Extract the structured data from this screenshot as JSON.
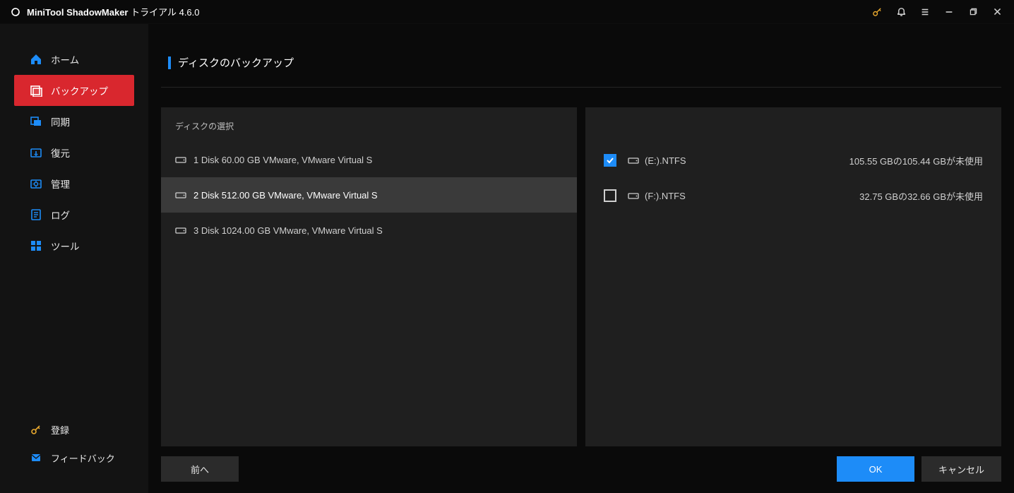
{
  "app": {
    "name_bold": "MiniTool ShadowMaker",
    "name_rest": " トライアル 4.6.0"
  },
  "sidebar": {
    "items": [
      {
        "id": "home",
        "label": "ホーム"
      },
      {
        "id": "backup",
        "label": "バックアップ"
      },
      {
        "id": "sync",
        "label": "同期"
      },
      {
        "id": "restore",
        "label": "復元"
      },
      {
        "id": "manage",
        "label": "管理"
      },
      {
        "id": "log",
        "label": "ログ"
      },
      {
        "id": "tools",
        "label": "ツール"
      }
    ],
    "bottom": [
      {
        "id": "register",
        "label": "登録"
      },
      {
        "id": "feedback",
        "label": "フィードバック"
      }
    ],
    "active_id": "backup"
  },
  "page": {
    "title": "ディスクのバックアップ"
  },
  "left_panel": {
    "header": "ディスクの選択",
    "disks": [
      {
        "label": "1 Disk 60.00 GB VMware,  VMware Virtual S",
        "selected": false
      },
      {
        "label": "2 Disk 512.00 GB VMware,  VMware Virtual S",
        "selected": true
      },
      {
        "label": "3 Disk 1024.00 GB VMware,  VMware Virtual S",
        "selected": false
      }
    ]
  },
  "right_panel": {
    "partitions": [
      {
        "label": "(E:).NTFS",
        "status": "105.55 GBの105.44 GBが未使用",
        "checked": true
      },
      {
        "label": "(F:).NTFS",
        "status": "32.75 GBの32.66 GBが未使用",
        "checked": false
      }
    ]
  },
  "footer": {
    "back": "前へ",
    "ok": "OK",
    "cancel": "キャンセル"
  },
  "colors": {
    "accent_red": "#d9272e",
    "accent_blue": "#1d8cf8"
  }
}
